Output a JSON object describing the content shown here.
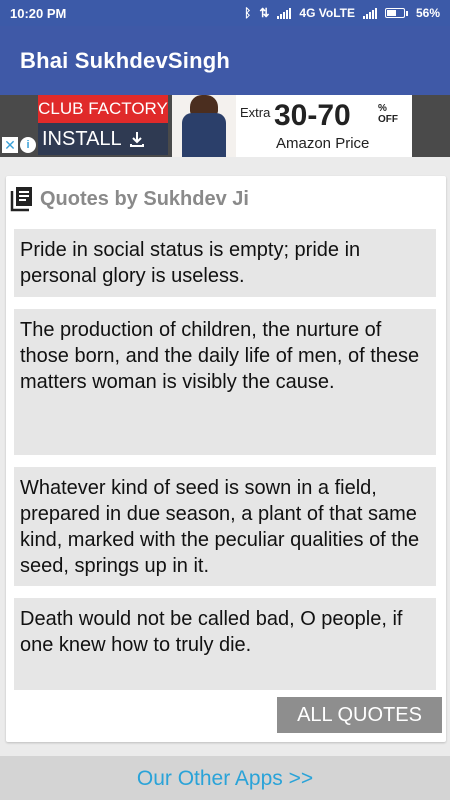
{
  "status_bar": {
    "time": "10:20 PM",
    "network": "4G VoLTE",
    "battery": "56%",
    "battery_level": 0.56
  },
  "app_bar": {
    "title": "Bhai SukhdevSingh"
  },
  "ad": {
    "brand": "CLUB FACTORY",
    "install": "INSTALL",
    "extra": "Extra",
    "discount": "30-70",
    "percent": "%",
    "off": "OFF",
    "price_label": "Amazon Price",
    "close_icon": "close-icon",
    "info_icon": "info-icon"
  },
  "card": {
    "title": "Quotes by Sukhdev Ji",
    "icon": "book-list-icon",
    "quotes": [
      "Pride in social status is empty; pride in personal glory is useless.",
      "The production of children, the nurture of those born, and the daily life of men, of these matters woman is visibly the cause.",
      "Whatever kind of seed is sown in a field, prepared in due season, a plant of that same kind, marked with the peculiar qualities of the seed, springs up in it.",
      "Death would not be called bad, O people, if one knew how to truly die."
    ],
    "all_quotes_label": "ALL QUOTES"
  },
  "footer": {
    "other_apps": "Our Other Apps >>"
  },
  "colors": {
    "primary": "#3f59a7",
    "link": "#2aa3d8",
    "quote_bg": "#e6e6e6",
    "button": "#8e8e8e"
  }
}
